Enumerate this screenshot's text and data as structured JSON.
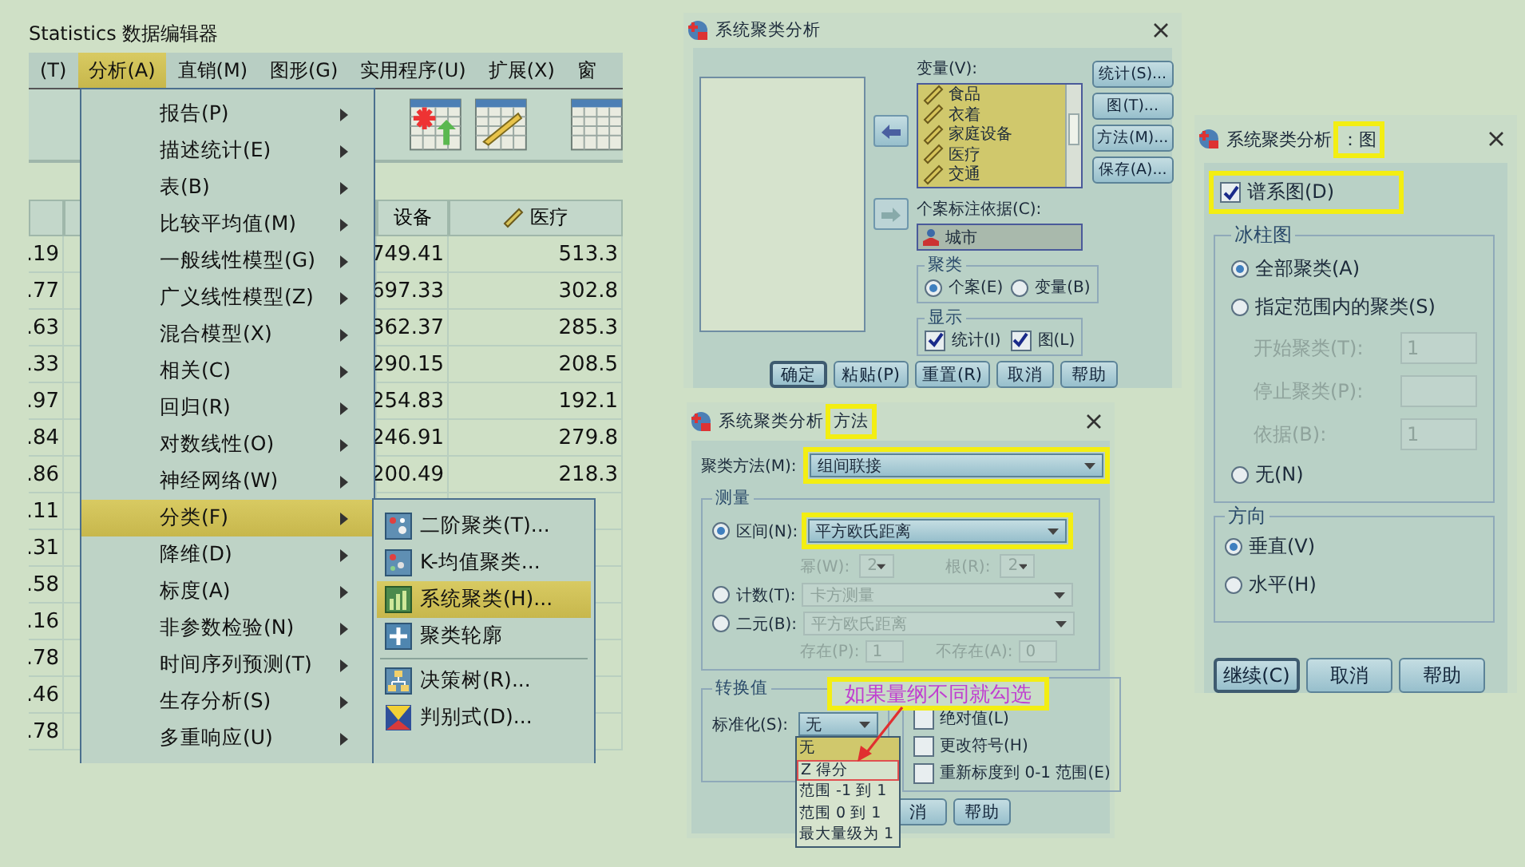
{
  "data_editor": {
    "title": "Statistics 数据编辑器",
    "menubar": [
      {
        "label": "(T)",
        "selected": false
      },
      {
        "label": "分析(A)",
        "selected": true
      },
      {
        "label": "直销(M)",
        "selected": false
      },
      {
        "label": "图形(G)",
        "selected": false
      },
      {
        "label": "实用程序(U)",
        "selected": false
      },
      {
        "label": "扩展(X)",
        "selected": false
      },
      {
        "label": "窗",
        "selected": false
      }
    ],
    "columns": [
      "设备",
      "医疗"
    ],
    "rows": [
      {
        "c1": ".19",
        "equip": "749.41",
        "medical": "513.3"
      },
      {
        "c1": ".77",
        "equip": "697.33",
        "medical": "302.8"
      },
      {
        "c1": ".63",
        "equip": "362.37",
        "medical": "285.3"
      },
      {
        "c1": ".33",
        "equip": "290.15",
        "medical": "208.5"
      },
      {
        "c1": ".97",
        "equip": "254.83",
        "medical": "192.1"
      },
      {
        "c1": ".84",
        "equip": "246.91",
        "medical": "279.8"
      },
      {
        "c1": ".86",
        "equip": "200.49",
        "medical": "218.3"
      },
      {
        "c1": ".11"
      },
      {
        "c1": ".31"
      },
      {
        "c1": ".58"
      },
      {
        "c1": ".16"
      },
      {
        "c1": ".78"
      },
      {
        "c1": ".46"
      },
      {
        "c1": ".78"
      }
    ],
    "analyze_menu": [
      {
        "label": "报告(P)",
        "selected": false
      },
      {
        "label": "描述统计(E)",
        "selected": false
      },
      {
        "label": "表(B)",
        "selected": false
      },
      {
        "label": "比较平均值(M)",
        "selected": false
      },
      {
        "label": "一般线性模型(G)",
        "selected": false
      },
      {
        "label": "广义线性模型(Z)",
        "selected": false
      },
      {
        "label": "混合模型(X)",
        "selected": false
      },
      {
        "label": "相关(C)",
        "selected": false
      },
      {
        "label": "回归(R)",
        "selected": false
      },
      {
        "label": "对数线性(O)",
        "selected": false
      },
      {
        "label": "神经网络(W)",
        "selected": false
      },
      {
        "label": "分类(F)",
        "selected": true
      },
      {
        "label": "降维(D)",
        "selected": false
      },
      {
        "label": "标度(A)",
        "selected": false
      },
      {
        "label": "非参数检验(N)",
        "selected": false
      },
      {
        "label": "时间序列预测(T)",
        "selected": false
      },
      {
        "label": "生存分析(S)",
        "selected": false
      },
      {
        "label": "多重响应(U)",
        "selected": false
      }
    ],
    "classify_submenu": [
      {
        "label": "二阶聚类(T)...",
        "selected": false,
        "kind": "twostep"
      },
      {
        "label": "K-均值聚类...",
        "selected": false,
        "kind": "kmeans"
      },
      {
        "label": "系统聚类(H)...",
        "selected": true,
        "kind": "hierarchical"
      },
      {
        "label": "聚类轮廓",
        "selected": false,
        "kind": "profile"
      },
      {
        "label": "决策树(R)...",
        "selected": false,
        "kind": "tree",
        "divider_before": true
      },
      {
        "label": "判别式(D)...",
        "selected": false,
        "kind": "discriminant"
      }
    ]
  },
  "hierarchical_dialog": {
    "title": "系统聚类分析",
    "transfer_buttons": [
      {
        "disabled": false
      },
      {
        "disabled": true
      }
    ],
    "variables_label": "变量(V):",
    "variables": [
      "食品",
      "衣着",
      "家庭设备",
      "医疗",
      "交通"
    ],
    "side_buttons": [
      "统计(S)...",
      "图(T)...",
      "方法(M)...",
      "保存(A)..."
    ],
    "label_by_label": "个案标注依据(C):",
    "label_by_value": "城市",
    "cluster_group": {
      "title": "聚类",
      "options": [
        {
          "label": "个案(E)",
          "selected": true
        },
        {
          "label": "变量(B)",
          "selected": false
        }
      ]
    },
    "display_group": {
      "title": "显示",
      "options": [
        {
          "label": "统计(I)",
          "checked": true
        },
        {
          "label": "图(L)",
          "checked": true
        }
      ]
    },
    "buttons": [
      {
        "label": "确定",
        "default": true
      },
      {
        "label": "粘贴(P)",
        "default": false
      },
      {
        "label": "重置(R)",
        "default": false
      },
      {
        "label": "取消",
        "default": false
      },
      {
        "label": "帮助",
        "default": false
      }
    ]
  },
  "method_dialog": {
    "title": "系统聚类分析",
    "title_suffix": {
      "text": "方法",
      "highlighted": true
    },
    "cluster_method": {
      "label": "聚类方法(M):",
      "value": "组间联接",
      "highlighted": true
    },
    "measure": {
      "title": "测量",
      "interval": {
        "label": "区间(N):",
        "selected": true,
        "value": "平方欧氏距离",
        "highlighted": true
      },
      "power": {
        "label": "幂(W):",
        "value": "2",
        "disabled": true
      },
      "root": {
        "label": "根(R):",
        "value": "2",
        "disabled": true
      },
      "counts": {
        "label": "计数(T):",
        "selected": false,
        "value": "卡方测量",
        "disabled": true
      },
      "binary": {
        "label": "二元(B):",
        "selected": false,
        "value": "平方欧氏距离",
        "disabled": true
      },
      "present": {
        "label": "存在(P):",
        "value": "1",
        "disabled": true
      },
      "absent": {
        "label": "不存在(A):",
        "value": "0",
        "disabled": true
      }
    },
    "transform_values": {
      "title": "转换值",
      "standardize_label": "标准化(S):",
      "standardize_value": "无",
      "options": [
        {
          "label": "无",
          "selected": true,
          "marked": false
        },
        {
          "label": "Z 得分",
          "selected": false,
          "marked": true
        },
        {
          "label": "范围 -1 到 1",
          "selected": false,
          "marked": false
        },
        {
          "label": "范围 0 到 1",
          "selected": false,
          "marked": false
        },
        {
          "label": "最大量级为 1",
          "selected": false,
          "marked": false
        }
      ]
    },
    "transform_measures": [
      {
        "label": "绝对值(L)",
        "checked": false
      },
      {
        "label": "更改符号(H)",
        "checked": false
      },
      {
        "label": "重新标度到 0-1 范围(E)",
        "checked": false
      }
    ],
    "buttons": [
      "消",
      "帮助"
    ],
    "annotation": "如果量纲不同就勾选"
  },
  "plots_dialog": {
    "title": "系统聚类分析",
    "title_suffix": {
      "text": "：图",
      "highlighted": true
    },
    "dendrogram": {
      "label": "谱系图(D)",
      "checked": true,
      "highlighted": true
    },
    "icicle": {
      "title": "冰柱图",
      "items": [
        {
          "kind": "radio",
          "label": "全部聚类(A)",
          "selected": true
        },
        {
          "kind": "radio",
          "label": "指定范围内的聚类(S)",
          "selected": false
        },
        {
          "kind": "field",
          "label": "开始聚类(T):",
          "value": "1",
          "disabled": true
        },
        {
          "kind": "field",
          "label": "停止聚类(P):",
          "disabled": true
        },
        {
          "kind": "field",
          "label": "依据(B):",
          "value": "1",
          "disabled": true
        },
        {
          "kind": "radio",
          "label": "无(N)",
          "selected": false
        }
      ]
    },
    "orientation": {
      "title": "方向",
      "options": [
        {
          "label": "垂直(V)",
          "selected": true
        },
        {
          "label": "水平(H)",
          "selected": false
        }
      ]
    },
    "buttons": [
      {
        "label": "继续(C)",
        "default": true
      },
      {
        "label": "取消",
        "default": false
      },
      {
        "label": "帮助",
        "default": false
      }
    ]
  }
}
